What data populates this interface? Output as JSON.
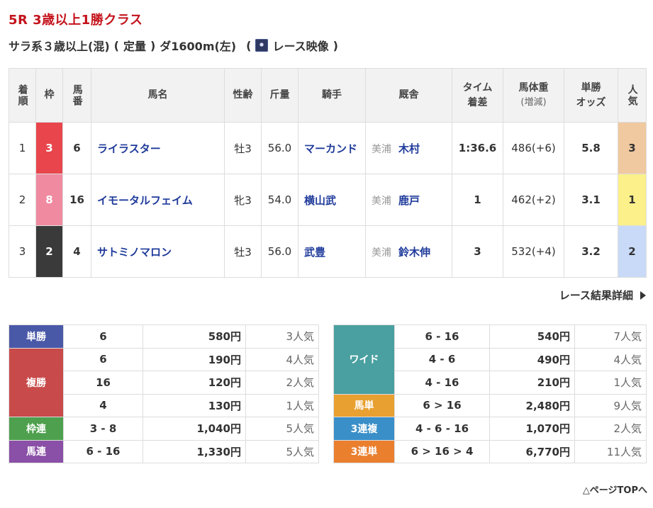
{
  "race": {
    "title": "5R 3歳以上1勝クラス",
    "class": "サラ系３歳以上(混)",
    "weight_rule": "定量",
    "course": "ダ1600m(左)",
    "video_label": "レース映像"
  },
  "headers": {
    "rank": "着順",
    "waku": "枠",
    "num": "馬番",
    "horse": "馬名",
    "sexage": "性齢",
    "weight": "斤量",
    "jockey": "騎手",
    "trainer": "厩舎",
    "time1": "タイム",
    "time2": "着差",
    "body1": "馬体重",
    "body2": "(増減)",
    "odds1": "単勝",
    "odds2": "オッズ",
    "pop": "人気"
  },
  "results": [
    {
      "rank": "1",
      "waku": "3",
      "waku_color": "#e8464c",
      "num": "6",
      "horse": "ライラスター",
      "sexage": "牡3",
      "weight": "56.0",
      "jockey": "マーカンド",
      "belong": "美浦",
      "trainer": "木村",
      "time": "1:36.6",
      "body": "486(+6)",
      "odds": "5.8",
      "pop": "3",
      "pop_color": "#f0c9a0"
    },
    {
      "rank": "2",
      "waku": "8",
      "waku_color": "#f08aa0",
      "num": "16",
      "horse": "イモータルフェイム",
      "sexage": "牝3",
      "weight": "54.0",
      "jockey": "横山武",
      "belong": "美浦",
      "trainer": "鹿戸",
      "time": "1",
      "body": "462(+2)",
      "odds": "3.1",
      "pop": "1",
      "pop_color": "#fbf08a"
    },
    {
      "rank": "3",
      "waku": "2",
      "waku_color": "#3a3a3a",
      "num": "4",
      "horse": "サトミノマロン",
      "sexage": "牡3",
      "weight": "56.0",
      "jockey": "武豊",
      "belong": "美浦",
      "trainer": "鈴木伸",
      "time": "3",
      "body": "532(+4)",
      "odds": "3.2",
      "pop": "2",
      "pop_color": "#c8daf7"
    }
  ],
  "detail_link": "レース結果詳細",
  "payouts_left": {
    "tansho": {
      "label": "単勝",
      "color": "#4a58a8",
      "rows": [
        {
          "combo": "6",
          "yen": "580円",
          "ninki": "3人気"
        }
      ]
    },
    "fukusho": {
      "label": "複勝",
      "color": "#c84a4a",
      "rows": [
        {
          "combo": "6",
          "yen": "190円",
          "ninki": "4人気"
        },
        {
          "combo": "16",
          "yen": "120円",
          "ninki": "2人気"
        },
        {
          "combo": "4",
          "yen": "130円",
          "ninki": "1人気"
        }
      ]
    },
    "wakuren": {
      "label": "枠連",
      "color": "#4ea04e",
      "rows": [
        {
          "combo": "3 - 8",
          "yen": "1,040円",
          "ninki": "5人気"
        }
      ]
    },
    "umaren": {
      "label": "馬連",
      "color": "#8a4fa6",
      "rows": [
        {
          "combo": "6 - 16",
          "yen": "1,330円",
          "ninki": "5人気"
        }
      ]
    }
  },
  "payouts_right": {
    "wide": {
      "label": "ワイド",
      "color": "#4aa0a0",
      "rows": [
        {
          "combo": "6 - 16",
          "yen": "540円",
          "ninki": "7人気"
        },
        {
          "combo": "4 - 6",
          "yen": "490円",
          "ninki": "4人気"
        },
        {
          "combo": "4 - 16",
          "yen": "210円",
          "ninki": "1人気"
        }
      ]
    },
    "umatan": {
      "label": "馬単",
      "color": "#e8a030",
      "rows": [
        {
          "combo": "6 > 16",
          "yen": "2,480円",
          "ninki": "9人気"
        }
      ]
    },
    "sanrenpuku": {
      "label": "3連複",
      "color": "#3a8fc8",
      "rows": [
        {
          "combo": "4 - 6 - 16",
          "yen": "1,070円",
          "ninki": "2人気"
        }
      ]
    },
    "sanrentan": {
      "label": "3連単",
      "color": "#ea7f2e",
      "rows": [
        {
          "combo": "6 > 16 > 4",
          "yen": "6,770円",
          "ninki": "11人気"
        }
      ]
    }
  },
  "page_top": "△ページTOPへ"
}
